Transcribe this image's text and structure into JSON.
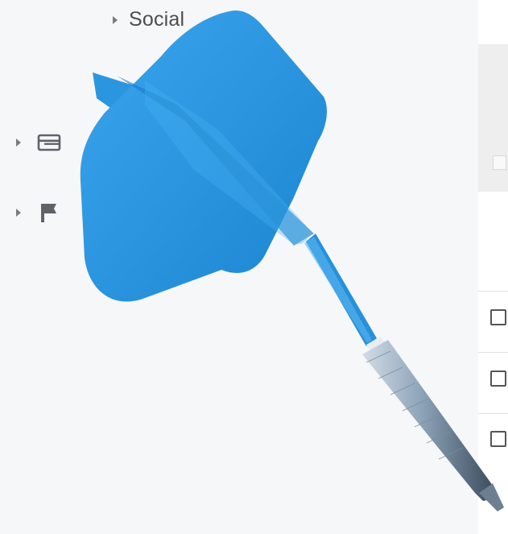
{
  "sidebar": {
    "items": [
      {
        "label": "Social",
        "caret_icon": "caret-right-icon"
      },
      {
        "label": "",
        "icon": "inbox-icon",
        "caret_icon": "caret-right-icon"
      },
      {
        "label": "",
        "icon": "flag-icon",
        "caret_icon": "caret-right-icon"
      }
    ]
  },
  "message_list": {
    "rows": [
      {
        "checked": false
      },
      {
        "checked": false
      },
      {
        "checked": false
      }
    ]
  },
  "overlay": {
    "icon": "dart-icon",
    "colors": {
      "flight": "#1c8ad6",
      "flight_light": "#3aa6ee",
      "shaft": "#2c95df",
      "barrel": "#8aa2b9"
    }
  }
}
